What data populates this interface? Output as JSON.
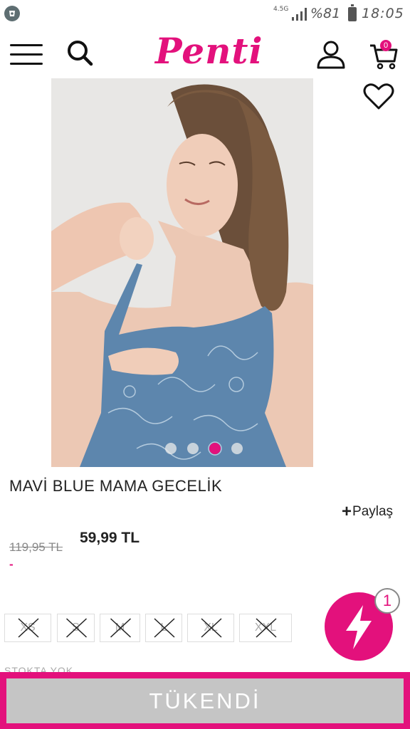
{
  "status_bar": {
    "network": "4.5G",
    "battery_percent": "%81",
    "time": "18:05"
  },
  "header": {
    "logo_text": "Penti",
    "cart_count": "0"
  },
  "product": {
    "name": "MAVİ BLUE MAMA GECELİK",
    "share_label": "Paylaş",
    "old_price": "119,95 TL",
    "discount": "-",
    "price": "59,99 TL",
    "image_index": 3,
    "image_count": 4,
    "sizes": [
      "XS",
      "S",
      "M",
      "L",
      "XL",
      "XXL"
    ],
    "stock_status": "STOKTA YOK"
  },
  "fab": {
    "badge_count": "1"
  },
  "footer": {
    "button_label": "TÜKENDİ"
  },
  "colors": {
    "brand": "#e3117c",
    "disabled_button": "#c5c5c5"
  }
}
